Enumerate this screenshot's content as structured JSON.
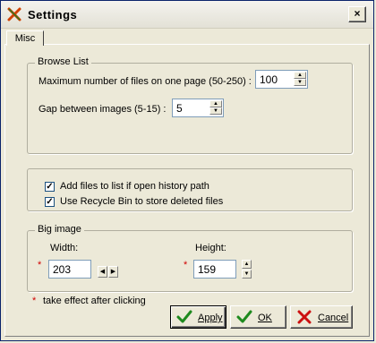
{
  "window": {
    "title": "Settings",
    "close_label": "×"
  },
  "tabs": [
    {
      "label": "Misc"
    }
  ],
  "browse_list": {
    "title": "Browse List",
    "max_files_label": "Maximum number of files on one page (50-250) :",
    "max_files_value": "100",
    "gap_label": "Gap between images (5-15) :",
    "gap_value": "5"
  },
  "options": {
    "add_files_label": "Add files to list if open history path",
    "add_files_checked": true,
    "recycle_label": "Use Recycle Bin to store deleted files",
    "recycle_checked": true
  },
  "big_image": {
    "title": "Big image",
    "width_label": "Width:",
    "width_value": "203",
    "height_label": "Height:",
    "height_value": "159",
    "star": "*"
  },
  "note": {
    "star": "*",
    "text": "take effect after clicking"
  },
  "buttons": {
    "apply": "Apply",
    "ok": "OK",
    "cancel": "Cancel"
  },
  "icons": {
    "app": "app-x-icon",
    "apply": "checkmark-icon",
    "ok": "checkmark-icon",
    "cancel": "red-x-icon"
  },
  "colors": {
    "check_green": "#1e8a1e",
    "cancel_red": "#cc1010",
    "star_red": "#d00000"
  }
}
